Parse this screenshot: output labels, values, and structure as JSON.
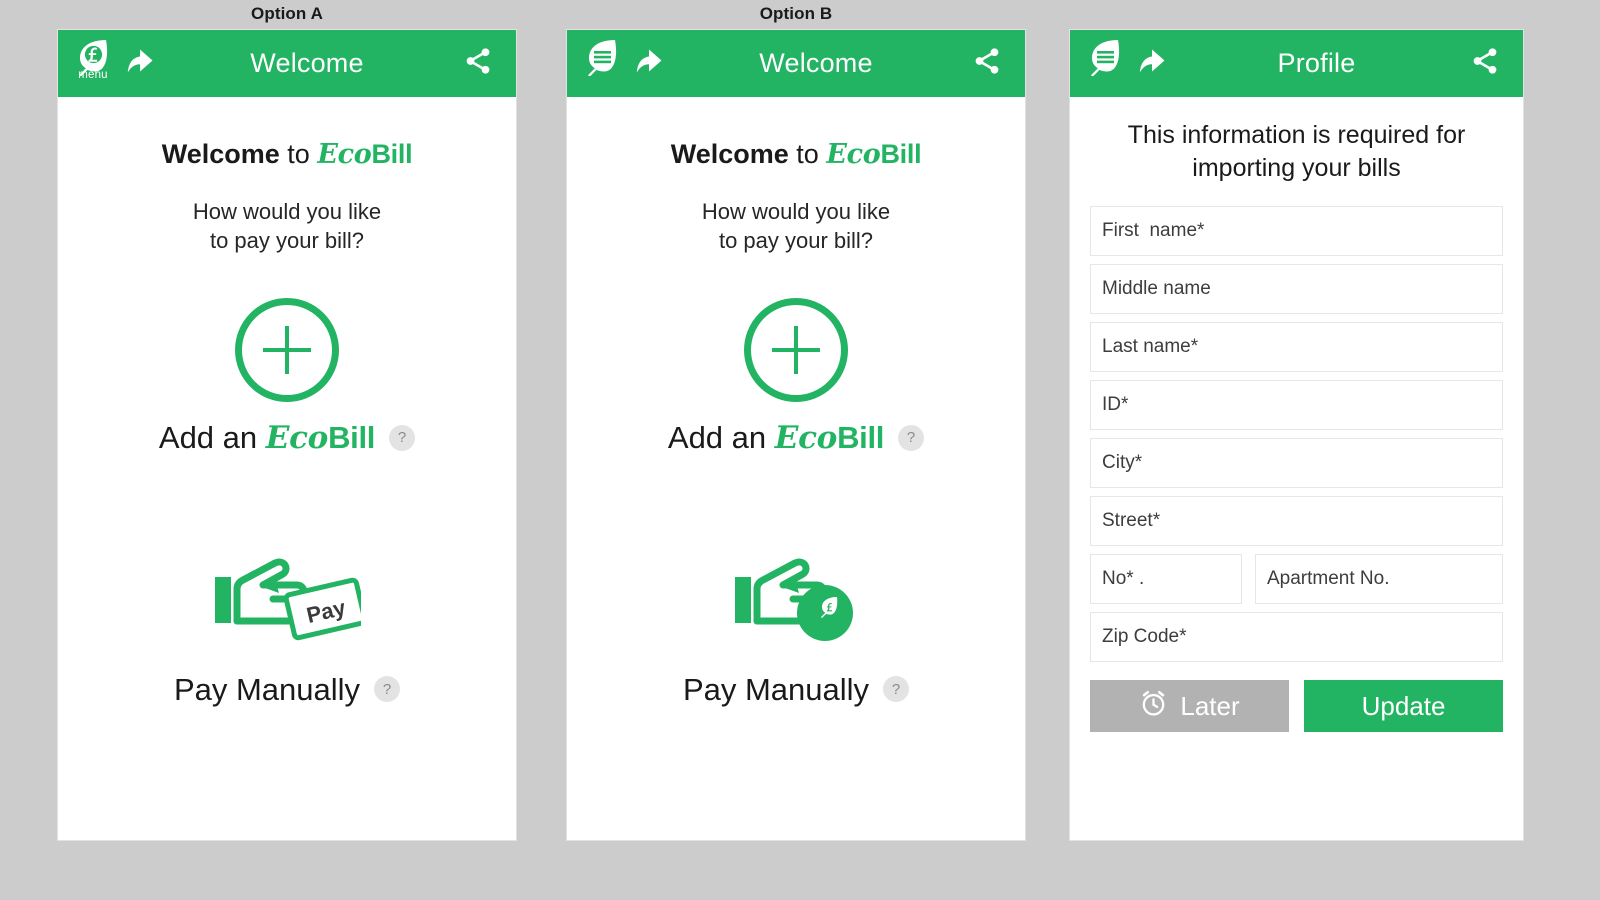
{
  "captions": {
    "option_a": "Option A",
    "option_b": "Option B"
  },
  "colors": {
    "brand_green": "#22b462",
    "page_background": "#cccccc",
    "panel_background": "#ffffff",
    "later_button_gray": "#b2b2b2",
    "help_badge_gray": "#e3e3e3",
    "field_border": "#e6e6e6",
    "text_dark": "#1a1a1a"
  },
  "screens": {
    "welcome_a": {
      "appbar": {
        "menu_icon": "leaf-currency-menu-icon",
        "menu_label": "menu",
        "back_icon": "back-arrow-icon",
        "title": "Welcome",
        "share_icon": "share-icon"
      },
      "heading": {
        "welcome_word": "Welcome",
        "to_word": "to",
        "brand_eco": "Eco",
        "brand_bill": "Bill"
      },
      "question_line_1": "How would you like",
      "question_line_2": "to pay your bill?",
      "actions": [
        {
          "icon": "plus-circle-icon",
          "label_prefix": "Add an",
          "label_brand_eco": "Eco",
          "label_brand_bill": "Bill",
          "help": "?"
        },
        {
          "icon": "hand-holding-pay-card-icon",
          "card_text": "Pay",
          "label": "Pay Manually",
          "help": "?"
        }
      ]
    },
    "welcome_b": {
      "appbar": {
        "menu_icon": "leaf-lines-menu-icon",
        "back_icon": "back-arrow-icon",
        "title": "Welcome",
        "share_icon": "share-icon"
      },
      "heading": {
        "welcome_word": "Welcome",
        "to_word": "to",
        "brand_eco": "Eco",
        "brand_bill": "Bill"
      },
      "question_line_1": "How would you like",
      "question_line_2": "to pay your bill?",
      "actions": [
        {
          "icon": "plus-circle-icon",
          "label_prefix": "Add an",
          "label_brand_eco": "Eco",
          "label_brand_bill": "Bill",
          "help": "?"
        },
        {
          "icon": "hand-holding-leaf-coin-icon",
          "label": "Pay Manually",
          "help": "?"
        }
      ]
    },
    "profile": {
      "appbar": {
        "menu_icon": "leaf-lines-menu-icon",
        "back_icon": "back-arrow-icon",
        "title": "Profile",
        "share_icon": "share-icon"
      },
      "note_line_1": "This information is required for",
      "note_line_2": "importing your bills",
      "fields": [
        {
          "name": "first-name",
          "placeholder": "First  name*"
        },
        {
          "name": "middle-name",
          "placeholder": "Middle name"
        },
        {
          "name": "last-name",
          "placeholder": "Last name*"
        },
        {
          "name": "id",
          "placeholder": "ID*"
        },
        {
          "name": "city",
          "placeholder": "City*"
        },
        {
          "name": "street",
          "placeholder": "Street*"
        },
        {
          "name": "house-number",
          "placeholder": "No* ."
        },
        {
          "name": "apartment-no",
          "placeholder": "Apartment No."
        },
        {
          "name": "zip-code",
          "placeholder": "Zip Code*"
        }
      ],
      "buttons": {
        "later_label": "Later",
        "later_icon": "alarm-clock-icon",
        "update_label": "Update"
      }
    }
  }
}
